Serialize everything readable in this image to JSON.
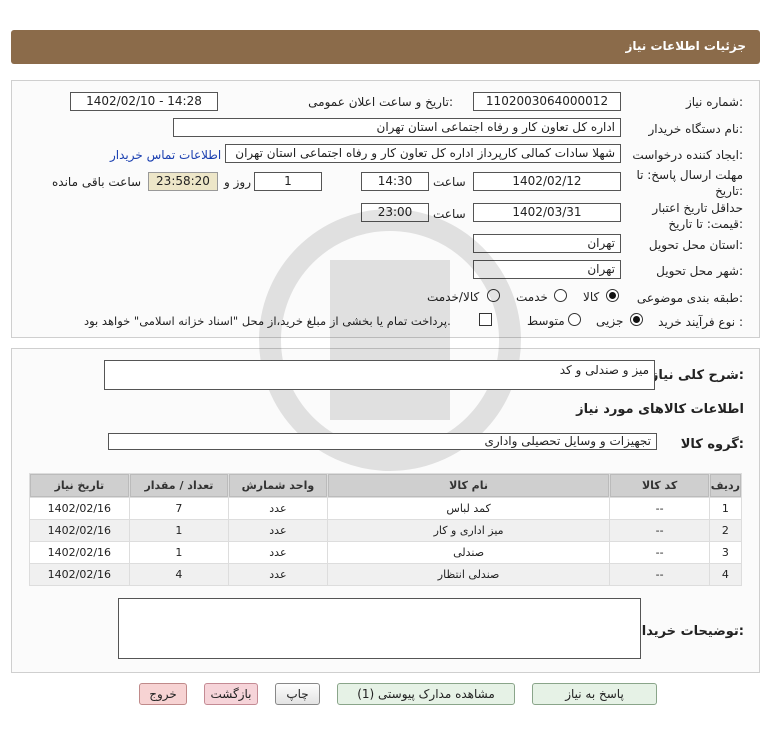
{
  "header": {
    "title": "جزئیات اطلاعات نیاز"
  },
  "form": {
    "need_number_label": "شماره نیاز:",
    "need_number": "1102003064000012",
    "announce_label": "تاریخ و ساعت اعلان عمومی:",
    "announce_value": "1402/02/10 - 14:28",
    "buyer_org_label": "نام دستگاه خریدار:",
    "buyer_org": "اداره کل تعاون  کار و رفاه اجتماعی استان تهران",
    "creator_label": "ایجاد کننده درخواست:",
    "creator": "شهلا سادات کمالی کارپرداز اداره کل تعاون  کار و رفاه اجتماعی استان تهران",
    "contact_link": "اطلاعات تماس خریدار",
    "reply_deadline_label_1": "مهلت ارسال پاسخ: تا",
    "reply_deadline_label_2": "تاریخ:",
    "reply_date": "1402/02/12",
    "time_label": "ساعت",
    "reply_time": "14:30",
    "days_value": "1",
    "days_label": "روز و",
    "remaining_time": "23:58:20",
    "remaining_label": "ساعت باقی مانده",
    "validity_label_1": "حداقل تاریخ اعتبار",
    "validity_label_2": "قیمت: تا تاریخ:",
    "validity_date": "1402/03/31",
    "validity_time_label": "ساعت",
    "validity_time": "23:00",
    "province_label": "استان محل تحویل:",
    "province": "تهران",
    "city_label": "شهر محل تحویل:",
    "city": "تهران",
    "category_label": "طبقه بندی موضوعی:",
    "category_options": [
      "کالا",
      "خدمت",
      "کالا/خدمت"
    ],
    "category_selected": "کالا",
    "process_label": "نوع فرآیند خرید :",
    "process_options": [
      "جزیی",
      "متوسط"
    ],
    "process_selected": "جزیی",
    "payment_note": "پرداخت تمام یا بخشی از مبلغ خرید،از محل \"اسناد خزانه اسلامی\" خواهد بود."
  },
  "summary": {
    "label": "شرح کلی نیاز:",
    "value": "میز و صندلی و کد",
    "goods_title": "اطلاعات کالاهای مورد نیاز",
    "group_label": "گروه کالا:",
    "group_value": "تجهیزات و وسایل تحصیلی واداری"
  },
  "table": {
    "headers": [
      "ردیف",
      "کد کالا",
      "نام کالا",
      "واحد شمارش",
      "تعداد / مقدار",
      "تاریخ نیاز"
    ],
    "rows": [
      [
        "1",
        "--",
        "کمد لباس",
        "عدد",
        "7",
        "1402/02/16"
      ],
      [
        "2",
        "--",
        "میز اداری و کار",
        "عدد",
        "1",
        "1402/02/16"
      ],
      [
        "3",
        "--",
        "صندلی",
        "عدد",
        "1",
        "1402/02/16"
      ],
      [
        "4",
        "--",
        "صندلی انتظار",
        "عدد",
        "4",
        "1402/02/16"
      ]
    ]
  },
  "buyer_notes": {
    "label": "توضیحات خریدار:",
    "value": ""
  },
  "buttons": {
    "reply": "پاسخ به نیاز",
    "attachments": "مشاهده مدارک پیوستی (1)",
    "print": "چاپ",
    "back": "بازگشت",
    "exit": "خروج"
  },
  "watermark": {
    "brand": "ParsNamadData",
    "subtitle": "پایگاه اطلاع رسانی مناقصات و مزایده",
    "phone": "۰۲۱-۸۸۳۴۹۶۷۰-۵"
  }
}
